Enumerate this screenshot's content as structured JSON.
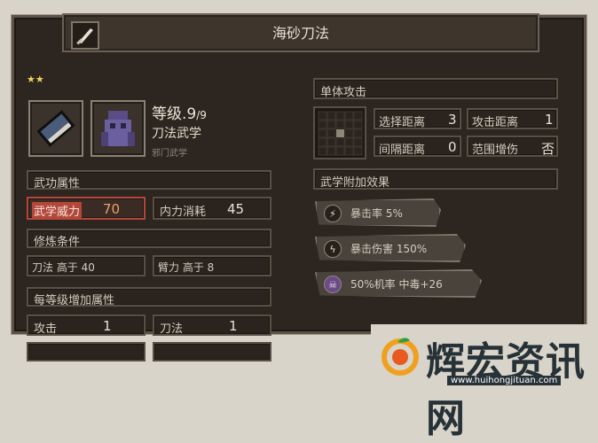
{
  "title": "海砂刀法",
  "stars": "★★",
  "skill": {
    "level_label": "等级",
    "level_value": ".9",
    "level_max": "/9",
    "type": "刀法武学",
    "sect": "邪门武学"
  },
  "attributes": {
    "section_title": "武功属性",
    "might_label": "武学威力",
    "might_value": "70",
    "cost_label": "内力消耗",
    "cost_value": "45"
  },
  "requirements": {
    "section_title": "修炼条件",
    "req1": "刀法 高于 40",
    "req2": "臂力 高于 8"
  },
  "per_level": {
    "section_title": "每等级增加属性",
    "row1_label": "攻击",
    "row1_value": "1",
    "row2_label": "刀法",
    "row2_value": "1"
  },
  "targeting": {
    "section_title": "单体攻击",
    "select_range_label": "选择距离",
    "select_range_value": "3",
    "attack_range_label": "攻击距离",
    "attack_range_value": "1",
    "interval_label": "间隔距离",
    "interval_value": "0",
    "aoe_label": "范围增伤",
    "aoe_value": "否"
  },
  "effects": {
    "section_title": "武学附加效果",
    "items": [
      {
        "icon": "crit-icon",
        "text": "暴击率 5%"
      },
      {
        "icon": "bolt-icon",
        "text": "暴击伤害 150%"
      },
      {
        "icon": "skull-icon",
        "text": "50%机率 中毒+26"
      }
    ]
  },
  "watermark": {
    "text": "辉宏资讯网",
    "url": "www.huihongjituan.com"
  },
  "colors": {
    "panel_bg": "#2d2620",
    "might_highlight": "#b3473a",
    "star": "#f4d35e",
    "poison_icon": "#6b4a8c"
  }
}
